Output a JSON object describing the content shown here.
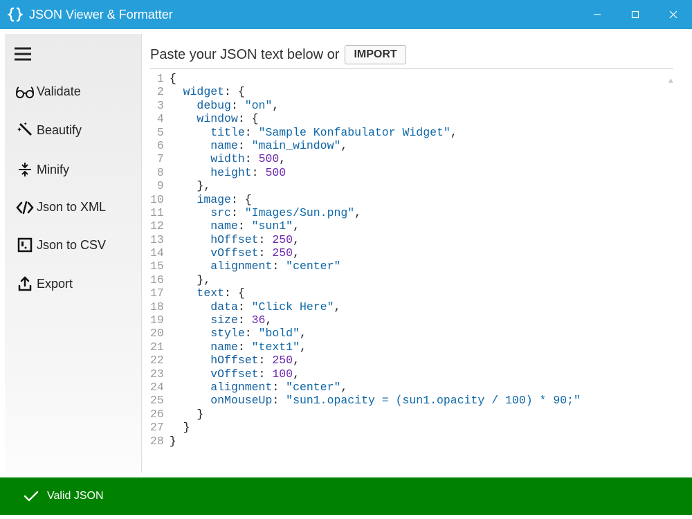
{
  "window": {
    "title": "JSON Viewer & Formatter"
  },
  "sidebar": {
    "items": [
      {
        "label": "Validate"
      },
      {
        "label": "Beautify"
      },
      {
        "label": "Minify"
      },
      {
        "label": "Json to XML"
      },
      {
        "label": "Json to CSV"
      },
      {
        "label": "Export"
      }
    ]
  },
  "main": {
    "instruction": "Paste your JSON text below or",
    "import_label": "IMPORT"
  },
  "editor": {
    "line_count": 28,
    "lines": [
      [
        {
          "t": "punc",
          "v": "{"
        }
      ],
      [
        {
          "t": "ind",
          "v": "  "
        },
        {
          "t": "k1",
          "v": "widget"
        },
        {
          "t": "punc",
          "v": ": {"
        }
      ],
      [
        {
          "t": "ind",
          "v": "    "
        },
        {
          "t": "k1",
          "v": "debug"
        },
        {
          "t": "punc",
          "v": ": "
        },
        {
          "t": "str",
          "v": "\"on\""
        },
        {
          "t": "punc",
          "v": ","
        }
      ],
      [
        {
          "t": "ind",
          "v": "    "
        },
        {
          "t": "k1",
          "v": "window"
        },
        {
          "t": "punc",
          "v": ": {"
        }
      ],
      [
        {
          "t": "ind",
          "v": "      "
        },
        {
          "t": "k1",
          "v": "title"
        },
        {
          "t": "punc",
          "v": ": "
        },
        {
          "t": "str",
          "v": "\"Sample Konfabulator Widget\""
        },
        {
          "t": "punc",
          "v": ","
        }
      ],
      [
        {
          "t": "ind",
          "v": "      "
        },
        {
          "t": "k1",
          "v": "name"
        },
        {
          "t": "punc",
          "v": ": "
        },
        {
          "t": "str",
          "v": "\"main_window\""
        },
        {
          "t": "punc",
          "v": ","
        }
      ],
      [
        {
          "t": "ind",
          "v": "      "
        },
        {
          "t": "k1",
          "v": "width"
        },
        {
          "t": "punc",
          "v": ": "
        },
        {
          "t": "num",
          "v": "500"
        },
        {
          "t": "punc",
          "v": ","
        }
      ],
      [
        {
          "t": "ind",
          "v": "      "
        },
        {
          "t": "k1",
          "v": "height"
        },
        {
          "t": "punc",
          "v": ": "
        },
        {
          "t": "num",
          "v": "500"
        }
      ],
      [
        {
          "t": "ind",
          "v": "    "
        },
        {
          "t": "punc",
          "v": "},"
        }
      ],
      [
        {
          "t": "ind",
          "v": "    "
        },
        {
          "t": "k1",
          "v": "image"
        },
        {
          "t": "punc",
          "v": ": {"
        }
      ],
      [
        {
          "t": "ind",
          "v": "      "
        },
        {
          "t": "k1",
          "v": "src"
        },
        {
          "t": "punc",
          "v": ": "
        },
        {
          "t": "str",
          "v": "\"Images/Sun.png\""
        },
        {
          "t": "punc",
          "v": ","
        }
      ],
      [
        {
          "t": "ind",
          "v": "      "
        },
        {
          "t": "k1",
          "v": "name"
        },
        {
          "t": "punc",
          "v": ": "
        },
        {
          "t": "str",
          "v": "\"sun1\""
        },
        {
          "t": "punc",
          "v": ","
        }
      ],
      [
        {
          "t": "ind",
          "v": "      "
        },
        {
          "t": "k1",
          "v": "hOffset"
        },
        {
          "t": "punc",
          "v": ": "
        },
        {
          "t": "num",
          "v": "250"
        },
        {
          "t": "punc",
          "v": ","
        }
      ],
      [
        {
          "t": "ind",
          "v": "      "
        },
        {
          "t": "k1",
          "v": "vOffset"
        },
        {
          "t": "punc",
          "v": ": "
        },
        {
          "t": "num",
          "v": "250"
        },
        {
          "t": "punc",
          "v": ","
        }
      ],
      [
        {
          "t": "ind",
          "v": "      "
        },
        {
          "t": "k1",
          "v": "alignment"
        },
        {
          "t": "punc",
          "v": ": "
        },
        {
          "t": "str",
          "v": "\"center\""
        }
      ],
      [
        {
          "t": "ind",
          "v": "    "
        },
        {
          "t": "punc",
          "v": "},"
        }
      ],
      [
        {
          "t": "ind",
          "v": "    "
        },
        {
          "t": "k1",
          "v": "text"
        },
        {
          "t": "punc",
          "v": ": {"
        }
      ],
      [
        {
          "t": "ind",
          "v": "      "
        },
        {
          "t": "k1",
          "v": "data"
        },
        {
          "t": "punc",
          "v": ": "
        },
        {
          "t": "str",
          "v": "\"Click Here\""
        },
        {
          "t": "punc",
          "v": ","
        }
      ],
      [
        {
          "t": "ind",
          "v": "      "
        },
        {
          "t": "k1",
          "v": "size"
        },
        {
          "t": "punc",
          "v": ": "
        },
        {
          "t": "num",
          "v": "36"
        },
        {
          "t": "punc",
          "v": ","
        }
      ],
      [
        {
          "t": "ind",
          "v": "      "
        },
        {
          "t": "k1",
          "v": "style"
        },
        {
          "t": "punc",
          "v": ": "
        },
        {
          "t": "str",
          "v": "\"bold\""
        },
        {
          "t": "punc",
          "v": ","
        }
      ],
      [
        {
          "t": "ind",
          "v": "      "
        },
        {
          "t": "k1",
          "v": "name"
        },
        {
          "t": "punc",
          "v": ": "
        },
        {
          "t": "str",
          "v": "\"text1\""
        },
        {
          "t": "punc",
          "v": ","
        }
      ],
      [
        {
          "t": "ind",
          "v": "      "
        },
        {
          "t": "k1",
          "v": "hOffset"
        },
        {
          "t": "punc",
          "v": ": "
        },
        {
          "t": "num",
          "v": "250"
        },
        {
          "t": "punc",
          "v": ","
        }
      ],
      [
        {
          "t": "ind",
          "v": "      "
        },
        {
          "t": "k1",
          "v": "vOffset"
        },
        {
          "t": "punc",
          "v": ": "
        },
        {
          "t": "num",
          "v": "100"
        },
        {
          "t": "punc",
          "v": ","
        }
      ],
      [
        {
          "t": "ind",
          "v": "      "
        },
        {
          "t": "k1",
          "v": "alignment"
        },
        {
          "t": "punc",
          "v": ": "
        },
        {
          "t": "str",
          "v": "\"center\""
        },
        {
          "t": "punc",
          "v": ","
        }
      ],
      [
        {
          "t": "ind",
          "v": "      "
        },
        {
          "t": "k1",
          "v": "onMouseUp"
        },
        {
          "t": "punc",
          "v": ": "
        },
        {
          "t": "str",
          "v": "\"sun1.opacity = (sun1.opacity / 100) * 90;\""
        }
      ],
      [
        {
          "t": "ind",
          "v": "    "
        },
        {
          "t": "punc",
          "v": "}"
        }
      ],
      [
        {
          "t": "ind",
          "v": "  "
        },
        {
          "t": "punc",
          "v": "}"
        }
      ],
      [
        {
          "t": "punc",
          "v": "}"
        }
      ]
    ]
  },
  "status": {
    "text": "Valid JSON"
  }
}
